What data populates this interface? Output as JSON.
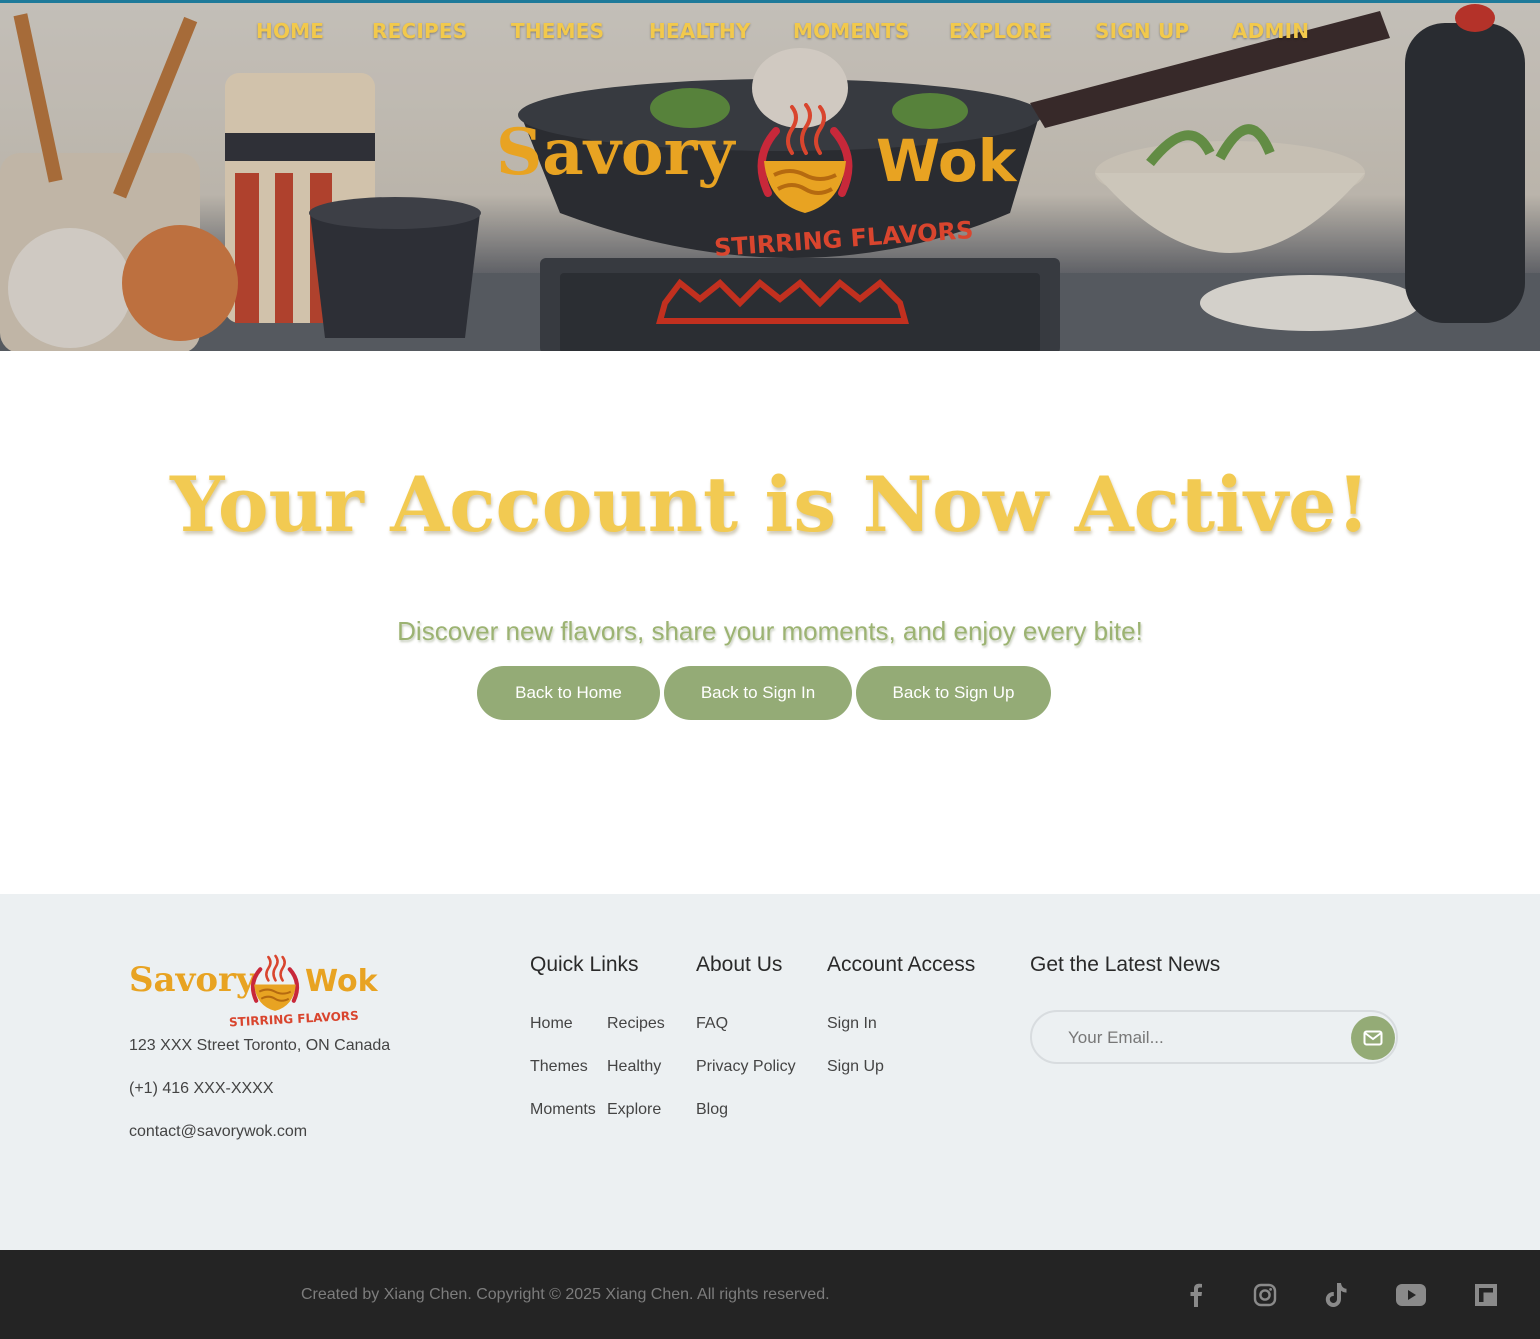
{
  "nav": {
    "items": [
      "HOME",
      "RECIPES",
      "THEMES",
      "HEALTHY",
      "MOMENTS",
      "EXPLORE",
      "SIGN UP",
      "ADMIN"
    ]
  },
  "logo": {
    "name_part1": "Savory",
    "name_part2": "Wok",
    "tagline": "STIRRING FLAVORS"
  },
  "main": {
    "title": "Your Account is Now Active!",
    "subtitle": "Discover new flavors, share your moments, and enjoy every bite!",
    "buttons": [
      "Back to Home",
      "Back to Sign In",
      "Back to Sign Up"
    ]
  },
  "footer": {
    "address": "123 XXX Street Toronto, ON Canada",
    "phone": "(+1) 416 XXX-XXXX",
    "email": "contact@savorywok.com",
    "quick_links": {
      "heading": "Quick Links",
      "items": [
        "Home",
        "Recipes",
        "Themes",
        "Healthy",
        "Moments",
        "Explore"
      ]
    },
    "about": {
      "heading": "About Us",
      "items": [
        "FAQ",
        "Privacy Policy",
        "Blog"
      ]
    },
    "account": {
      "heading": "Account Access",
      "items": [
        "Sign In",
        "Sign Up"
      ]
    },
    "newsletter": {
      "heading": "Get the Latest News",
      "placeholder": "Your Email..."
    }
  },
  "bottom": {
    "copyright": "Created by Xiang Chen. Copyright © 2025 Xiang Chen. All rights reserved.",
    "social_icons": [
      "facebook-icon",
      "instagram-icon",
      "tiktok-icon",
      "youtube-icon",
      "flipboard-icon"
    ]
  },
  "colors": {
    "accent_gold": "#f2ca52",
    "logo_orange": "#e8a322",
    "tagline_red": "#d9452e",
    "sage_green": "#94ab76",
    "footer_bg": "#ecf0f2",
    "bottom_bg": "#242424"
  }
}
